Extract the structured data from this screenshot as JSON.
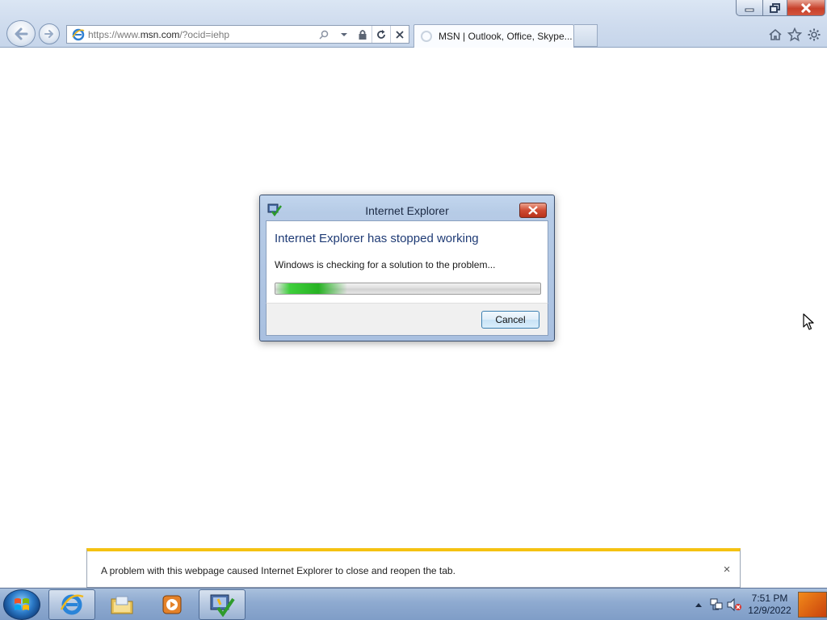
{
  "browser": {
    "address": {
      "url_prefix": "https://www.",
      "url_domain": "msn.com",
      "url_rest": "/?ocid=iehp"
    },
    "tab": {
      "title": "MSN | Outlook, Office, Skype..."
    }
  },
  "dialog": {
    "title": "Internet Explorer",
    "heading": "Internet Explorer has stopped working",
    "message": "Windows is checking for a solution to the problem...",
    "progress_fraction": 0.27,
    "cancel_label": "Cancel"
  },
  "notification": {
    "text": "A problem with this webpage caused Internet Explorer to close and reopen the tab.",
    "close_glyph": "×"
  },
  "taskbar": {
    "clock_time": "7:51 PM",
    "clock_date": "12/9/2022"
  },
  "colors": {
    "accent_blue": "#1f3b75",
    "notification_stripe": "#f5c211",
    "progress_green": "#27b223",
    "close_red": "#cf4a32"
  },
  "icons": [
    "back-arrow-icon",
    "forward-arrow-icon",
    "ie-page-icon",
    "search-icon",
    "lock-icon",
    "refresh-icon",
    "stop-icon",
    "home-icon",
    "favorites-star-icon",
    "tools-gear-icon",
    "problem-reporting-icon",
    "windows-logo-icon",
    "ie-icon",
    "folder-icon",
    "media-player-icon",
    "network-icon",
    "volume-muted-icon"
  ]
}
